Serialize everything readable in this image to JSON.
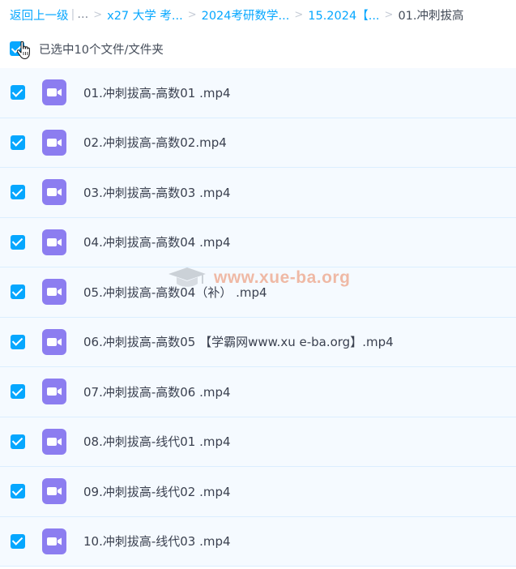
{
  "breadcrumb": {
    "back": "返回上一级",
    "bar": "|",
    "ellipsis": "...",
    "items": [
      {
        "label": "x27 大学 考..."
      },
      {
        "label": "2024考研数学..."
      },
      {
        "label": "15.2024【..."
      },
      {
        "label": "01.冲刺拔高"
      }
    ],
    "separator": ">"
  },
  "selection": {
    "label": "已选中10个文件/文件夹",
    "checked": true
  },
  "watermark": {
    "text": "www.xue-ba.org"
  },
  "files": [
    {
      "name": "01.冲刺拔高-高数01 .mp4",
      "checked": true,
      "icon": "video-icon"
    },
    {
      "name": "02.冲刺拔高-高数02.mp4",
      "checked": true,
      "icon": "video-icon"
    },
    {
      "name": "03.冲刺拔高-高数03 .mp4",
      "checked": true,
      "icon": "video-icon"
    },
    {
      "name": "04.冲刺拔高-高数04 .mp4",
      "checked": true,
      "icon": "video-icon"
    },
    {
      "name": "05.冲刺拔高-高数04（补） .mp4",
      "checked": true,
      "icon": "video-icon"
    },
    {
      "name": "06.冲刺拔高-高数05 【学霸网www.xu e-ba.org】.mp4",
      "checked": true,
      "icon": "video-icon"
    },
    {
      "name": "07.冲刺拔高-高数06 .mp4",
      "checked": true,
      "icon": "video-icon"
    },
    {
      "name": "08.冲刺拔高-线代01 .mp4",
      "checked": true,
      "icon": "video-icon"
    },
    {
      "name": "09.冲刺拔高-线代02 .mp4",
      "checked": true,
      "icon": "video-icon"
    },
    {
      "name": "10.冲刺拔高-线代03 .mp4",
      "checked": true,
      "icon": "video-icon"
    }
  ],
  "colors": {
    "accent": "#06a7ff",
    "video_icon": "#8c7df0",
    "row_bg": "#f5faff"
  }
}
